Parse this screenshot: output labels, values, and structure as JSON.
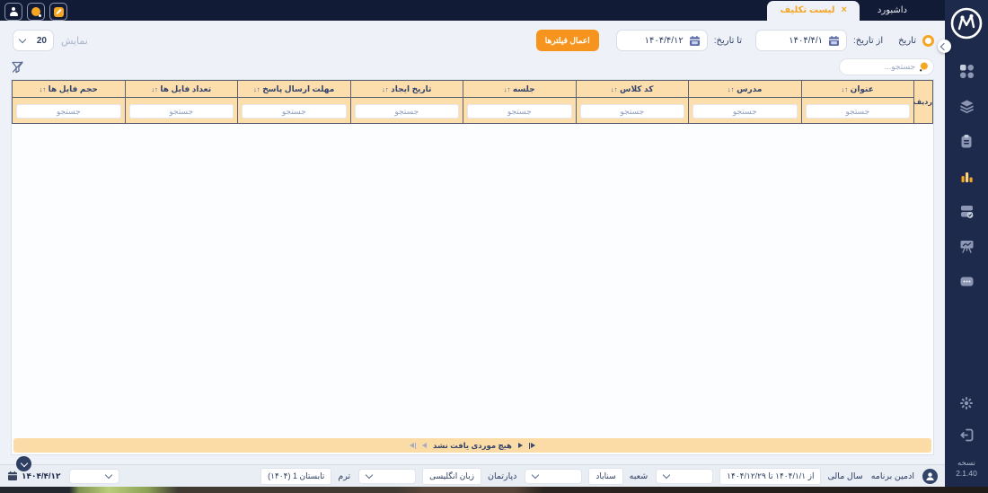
{
  "colors": {
    "navy": "#1d2a4b",
    "topbar": "#121b36",
    "accent_orange": "#f5a623",
    "button_orange": "#f7941e",
    "peach": "#fcdead",
    "content_bg": "#eef1f8",
    "statusbar_bg": "#e9edf4"
  },
  "topbar": {
    "tabs": [
      {
        "label": "داشبورد"
      },
      {
        "label": "لیست تکلیف"
      }
    ],
    "close_glyph": "×",
    "window_icons": [
      "user-icon",
      "notification-dot-icon",
      "edit-icon"
    ]
  },
  "filters": {
    "date_toggle_label": "تاریخ",
    "from_label": "از تاریخ:",
    "from_value": "۱۴۰۴/۴/۱",
    "to_label": "تا تاریخ:",
    "to_value": "۱۴۰۴/۴/۱۲",
    "apply_button": "اعمال فیلترها",
    "show_label": "نمایش",
    "page_size": "20",
    "search_placeholder": "جستجو..."
  },
  "table": {
    "row_header": "ردیف",
    "sort_glyph": "↑↓",
    "columns": [
      "عنوان",
      "مدرس",
      "کد کلاس",
      "جلسه",
      "تاریخ ایجاد",
      "مهلت ارسال پاسخ",
      "تعداد فایل ها",
      "حجم فایل ها"
    ],
    "column_search_placeholder": "جستجو",
    "empty_message": "هیچ موردی یافت نشد"
  },
  "sidebar": {
    "icons": [
      "dashboard-grid",
      "layers",
      "clipboard",
      "bar-chart",
      "finance-check",
      "presentation-chart",
      "more-ellipsis"
    ],
    "active_icon": "bar-chart",
    "footer_icons": [
      "settings-gear",
      "logout"
    ],
    "version_label": "نسخه",
    "version": "2.1.40"
  },
  "statusbar": {
    "user": "ادمین برنامه",
    "groups": [
      {
        "label": "سال مالی",
        "value": "از ۱۴۰۴/۱/۱ تا ۱۴۰۴/۱۲/۲۹"
      },
      {
        "label": "شعبه",
        "value": "سناباد"
      },
      {
        "label": "دپارتمان",
        "value": "زبان انگلیسی"
      },
      {
        "label": "ترم",
        "value": "تابستان 1 (۱۴۰۴)"
      }
    ],
    "today_date": "۱۴۰۴/۴/۱۲"
  }
}
